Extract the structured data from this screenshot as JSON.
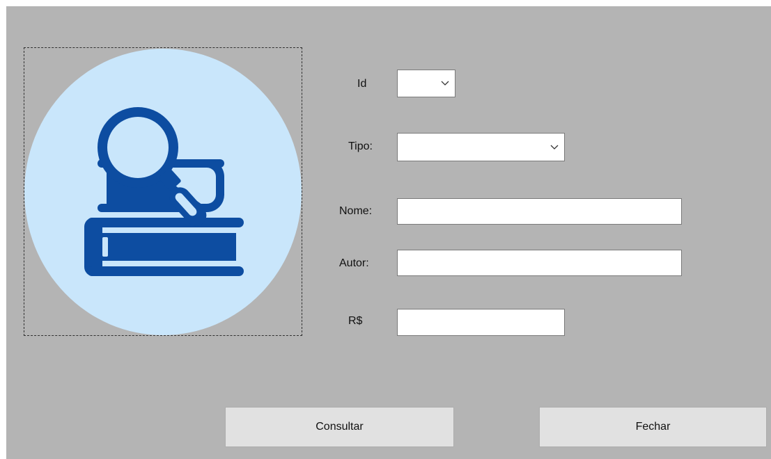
{
  "form": {
    "labels": {
      "id": "Id",
      "tipo": "Tipo:",
      "nome": "Nome:",
      "autor": "Autor:",
      "preco": "R$"
    },
    "fields": {
      "id": "",
      "tipo": "",
      "nome": "",
      "autor": "",
      "preco": ""
    },
    "buttons": {
      "consultar": "Consultar",
      "fechar": "Fechar"
    },
    "colors": {
      "form_background": "#b4b4b4",
      "circle": "#c9e6fb",
      "icon": "#0d4da1"
    },
    "picture": {
      "icon": "books-search-icon"
    }
  }
}
